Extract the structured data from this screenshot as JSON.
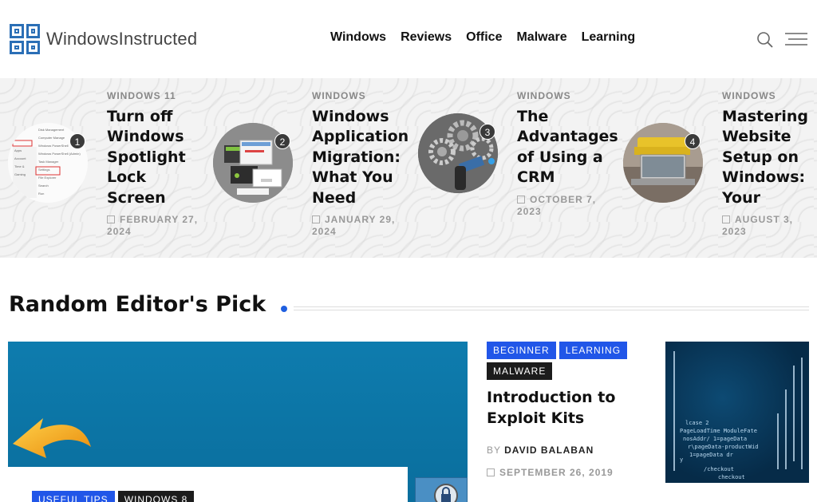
{
  "header": {
    "site_name": "WindowsInstructed",
    "nav": [
      "Windows",
      "Reviews",
      "Office",
      "Malware",
      "Learning"
    ],
    "icons": {
      "search": "search-icon",
      "menu": "hamburger-menu-icon"
    }
  },
  "slider": {
    "items": [
      {
        "rank": "1",
        "category": "WINDOWS 11",
        "title": "Turn off Windows Spotlight Lock Screen",
        "date": "FEBRUARY 27, 2024"
      },
      {
        "rank": "2",
        "category": "WINDOWS",
        "title": "Windows Application Migration: What You Need",
        "date": "JANUARY 29, 2024"
      },
      {
        "rank": "3",
        "category": "WINDOWS",
        "title": "The Advantages of Using a CRM",
        "date": "OCTOBER 7, 2023"
      },
      {
        "rank": "4",
        "category": "WINDOWS",
        "title": "Mastering Website Setup on Windows: Your",
        "date": "AUGUST 3, 2023"
      }
    ]
  },
  "section": {
    "title": "Random Editor's Pick"
  },
  "feature": {
    "tags": [
      "USEFUL TIPS",
      "WINDOWS 8"
    ]
  },
  "side_article": {
    "tags_row1": [
      "BEGINNER",
      "LEARNING"
    ],
    "tags_row2": [
      "MALWARE"
    ],
    "title": "Introduction to Exploit Kits",
    "by_label": "BY",
    "author": "DAVID BALABAN",
    "date": "SEPTEMBER 26, 2019"
  },
  "colors": {
    "accent": "#2156e8",
    "dark_tag": "#1c1c1c",
    "logo": "#2b6fb6"
  }
}
